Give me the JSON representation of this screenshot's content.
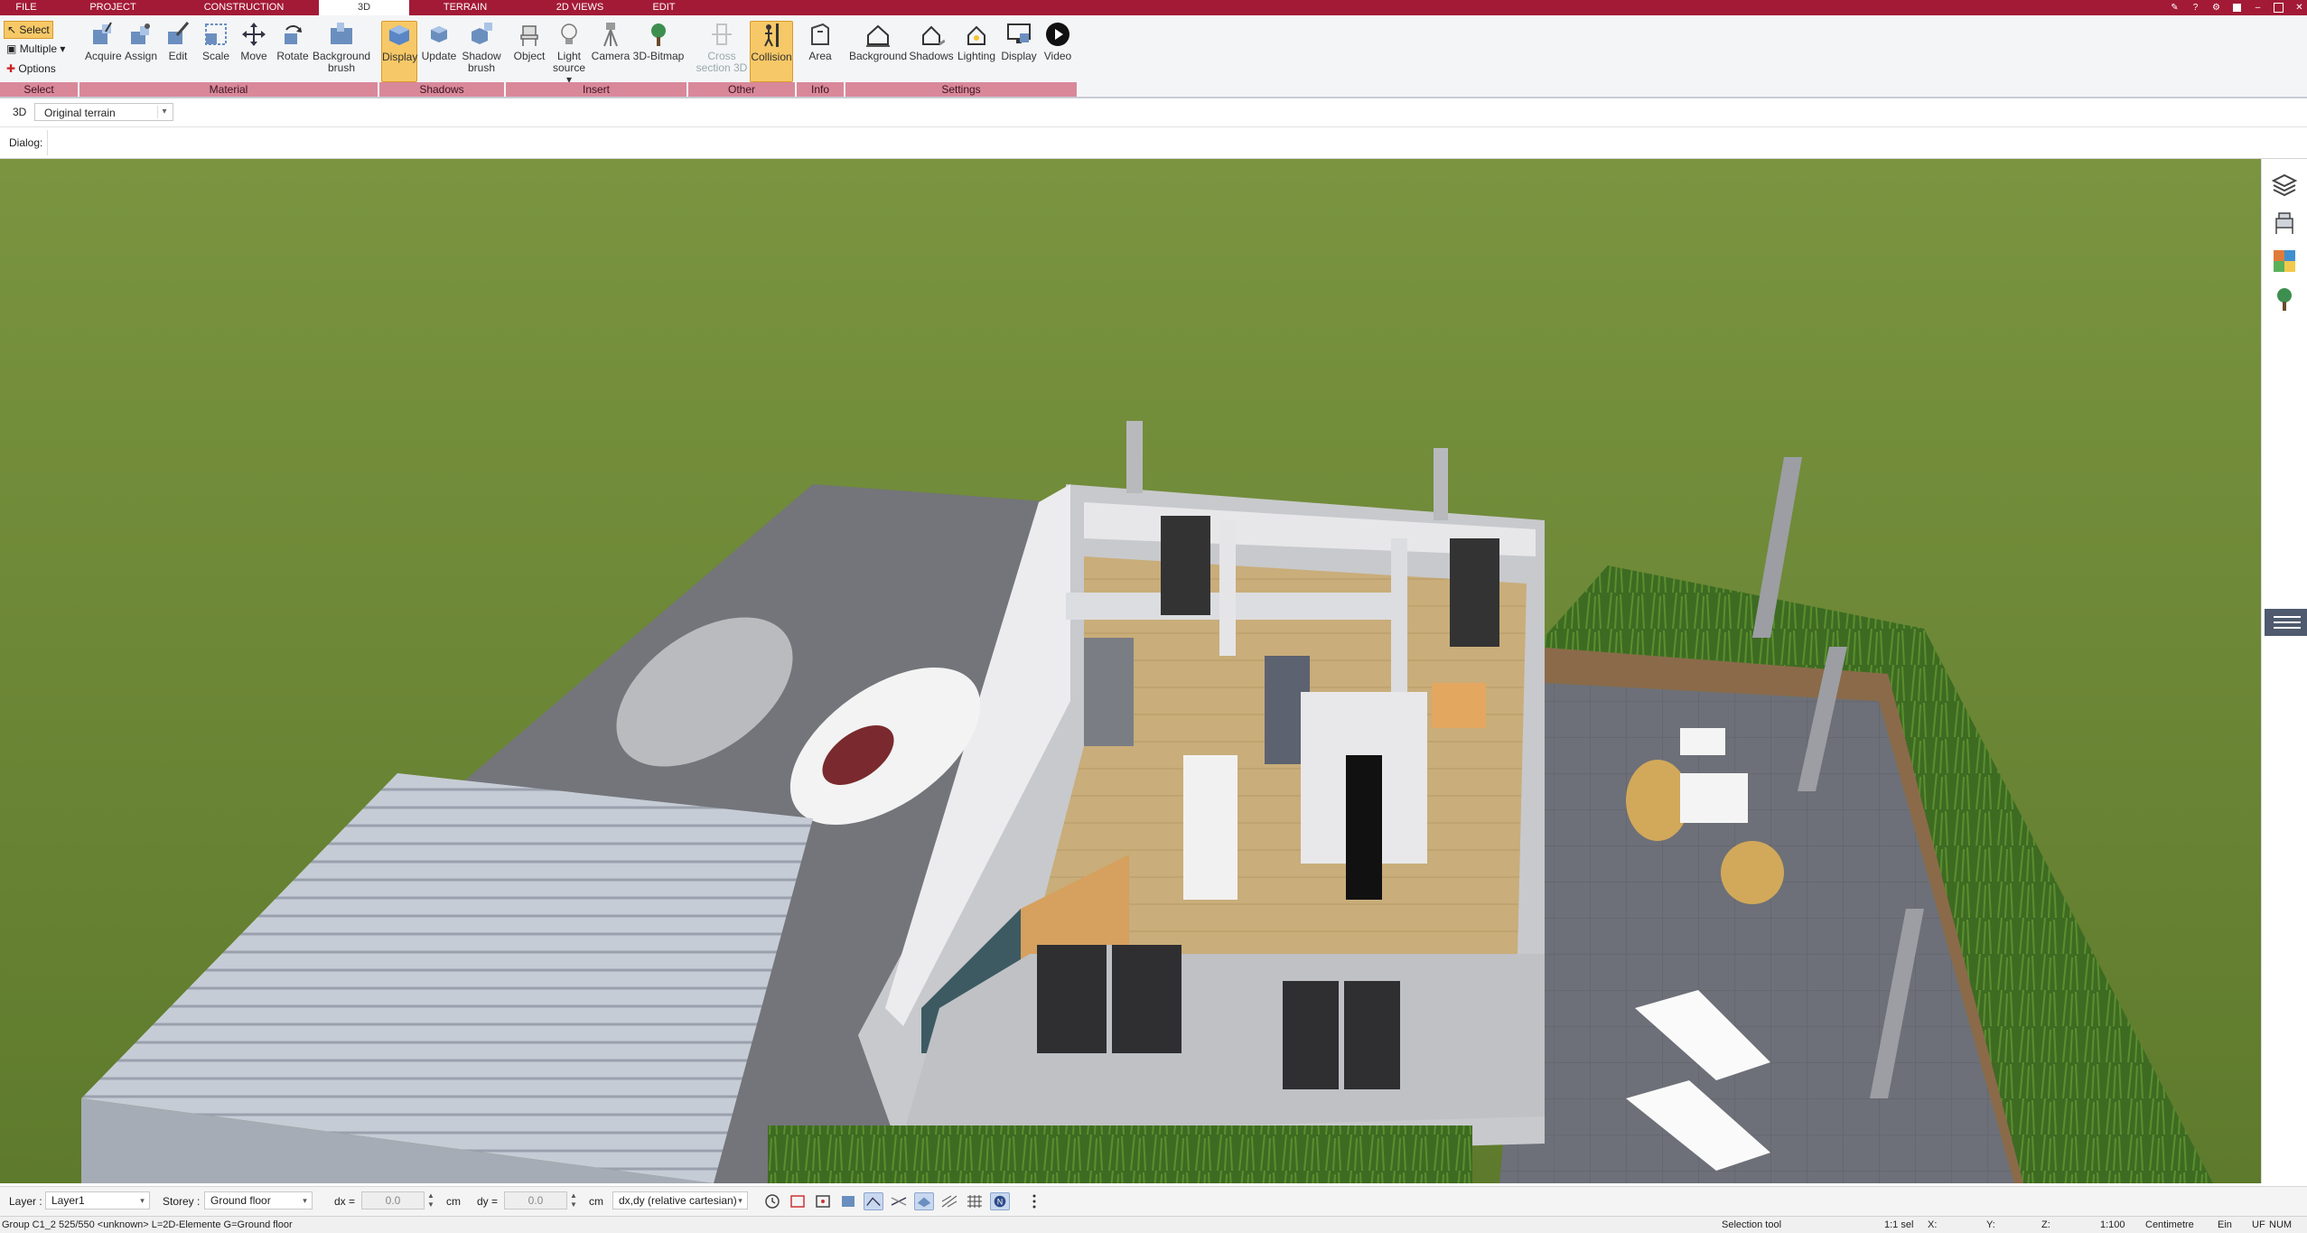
{
  "tabs": [
    {
      "label": "FILE",
      "active": false
    },
    {
      "label": "PROJECT",
      "active": false
    },
    {
      "label": "CONSTRUCTION",
      "active": false
    },
    {
      "label": "3D",
      "active": true
    },
    {
      "label": "TERRAIN",
      "active": false
    },
    {
      "label": "2D VIEWS",
      "active": false
    },
    {
      "label": "EDIT",
      "active": false
    }
  ],
  "ribbon": {
    "select_group": {
      "select": "Select",
      "multiple": "Multiple",
      "options": "Options",
      "title": "Select"
    },
    "material": {
      "title": "Material",
      "acquire": "Acquire",
      "assign": "Assign",
      "edit": "Edit",
      "scale": "Scale",
      "move": "Move",
      "rotate": "Rotate",
      "background_brush_1": "Background",
      "background_brush_2": "brush"
    },
    "shadows": {
      "title": "Shadows",
      "display": "Display",
      "update": "Update",
      "shadow_brush_1": "Shadow",
      "shadow_brush_2": "brush"
    },
    "insert": {
      "title": "Insert",
      "object": "Object",
      "light_source_1": "Light",
      "light_source_2": "source",
      "camera": "Camera",
      "bitmap_3d": "3D-Bitmap"
    },
    "other": {
      "title": "Other",
      "cross_section_1": "Cross",
      "cross_section_2": "section 3D",
      "collision": "Collision"
    },
    "info": {
      "title": "Info",
      "area": "Area"
    },
    "settings": {
      "title": "Settings",
      "background": "Background",
      "shadows": "Shadows",
      "lighting": "Lighting",
      "display": "Display",
      "video": "Video"
    }
  },
  "viewbar": {
    "mode": "3D",
    "terrain_option": "Original terrain"
  },
  "dialog": {
    "label": "Dialog:"
  },
  "bottombar": {
    "layer_label": "Layer :",
    "layer_value": "Layer1",
    "storey_label": "Storey :",
    "storey_value": "Ground floor",
    "dx_label": "dx =",
    "dx_value": "0.0",
    "dx_unit": "cm",
    "dy_label": "dy =",
    "dy_value": "0.0",
    "dy_unit": "cm",
    "coord_mode": "dx,dy (relative cartesian)"
  },
  "statusbar": {
    "info": "Group C1_2 525/550 <unknown> L=2D-Elemente G=Ground floor",
    "tool": "Selection tool",
    "scale_sel": "1:1 sel",
    "x_label": "X:",
    "y_label": "Y:",
    "z_label": "Z:",
    "scale": "1:100",
    "unit": "Centimetre",
    "ein": "Ein",
    "uf": "UF",
    "num": "NUM"
  },
  "colors": {
    "brand": "#a31a36",
    "group_band": "#d9889a",
    "active_button": "#f7c867",
    "grass": "#6f8a3a"
  },
  "icons": [
    "select-icon",
    "multiple-icon",
    "options-icon",
    "acquire-icon",
    "assign-icon",
    "edit-icon",
    "scale-icon",
    "move-icon",
    "rotate-icon",
    "background-brush-icon",
    "display-cube-icon",
    "update-icon",
    "shadow-brush-icon",
    "object-chair-icon",
    "lightbulb-icon",
    "camera-icon",
    "tree-icon",
    "cross-section-icon",
    "collision-icon",
    "area-icon",
    "background-house-icon",
    "shadows-house-icon",
    "lighting-house-icon",
    "display-monitor-icon",
    "video-play-icon",
    "layers-icon",
    "furniture-icon",
    "materials-icon",
    "plant-icon"
  ]
}
